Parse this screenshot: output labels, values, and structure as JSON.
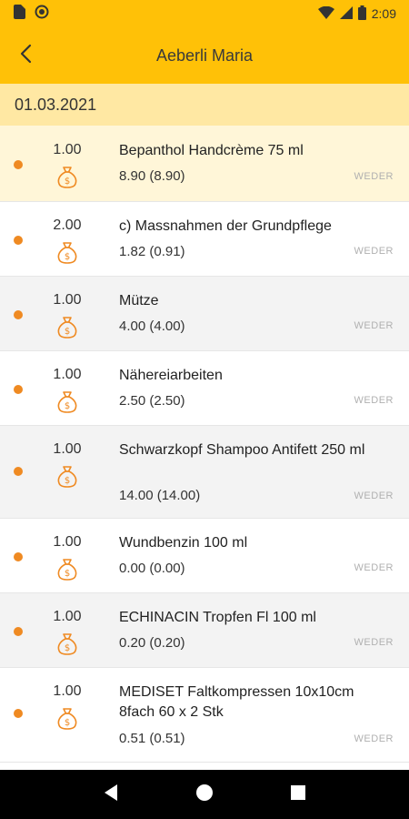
{
  "status_bar": {
    "time": "2:09"
  },
  "header": {
    "title": "Aeberli Maria",
    "back_icon": "back-arrow-icon"
  },
  "date": "01.03.2021",
  "items": [
    {
      "qty": "1.00",
      "name": "Bepanthol Handcrème 75 ml",
      "price": "8.90 (8.90)",
      "tag": "WEDER"
    },
    {
      "qty": "2.00",
      "name": "c) Massnahmen der Grundpflege",
      "price": "1.82 (0.91)",
      "tag": "WEDER"
    },
    {
      "qty": "1.00",
      "name": "Mütze",
      "price": "4.00 (4.00)",
      "tag": "WEDER"
    },
    {
      "qty": "1.00",
      "name": "Nähereiarbeiten",
      "price": "2.50 (2.50)",
      "tag": "WEDER"
    },
    {
      "qty": "1.00",
      "name": "Schwarzkopf Shampoo Antifett 250 ml",
      "price": "14.00 (14.00)",
      "tag": "WEDER"
    },
    {
      "qty": "1.00",
      "name": "Wundbenzin 100 ml",
      "price": "0.00 (0.00)",
      "tag": "WEDER"
    },
    {
      "qty": "1.00",
      "name": "ECHINACIN Tropfen Fl 100 ml",
      "price": "0.20 (0.20)",
      "tag": "WEDER"
    },
    {
      "qty": "1.00",
      "name": "MEDISET Faltkompressen 10x10cm 8fach 60 x 2 Stk",
      "price": "0.51 (0.51)",
      "tag": "WEDER"
    }
  ],
  "colors": {
    "accent": "#ffc107",
    "date_bar": "#ffe8a3",
    "highlight": "#fff6d8",
    "dot": "#ef8a22"
  }
}
